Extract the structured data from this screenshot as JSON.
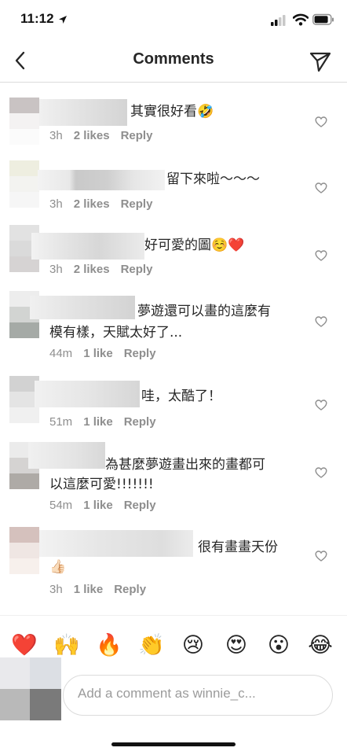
{
  "status_bar": {
    "time": "11:12"
  },
  "header": {
    "title": "Comments"
  },
  "comments": [
    {
      "text": "其實很好看🤣",
      "time": "3h",
      "likes": "2 likes",
      "reply": "Reply"
    },
    {
      "text": "留下來啦～～～",
      "time": "3h",
      "likes": "2 likes",
      "reply": "Reply"
    },
    {
      "text": "好可愛的圖☺️❤️",
      "time": "3h",
      "likes": "2 likes",
      "reply": "Reply"
    },
    {
      "text_line1": "夢遊還可以畫的這麼有",
      "text_line2": "模有樣，天賦太好了...",
      "time": "44m",
      "likes": "1 like",
      "reply": "Reply"
    },
    {
      "text": "哇，太酷了！",
      "time": "51m",
      "likes": "1 like",
      "reply": "Reply"
    },
    {
      "text_line1": "為甚麼夢遊畫出來的畫都可",
      "text_line2": "以這麼可愛!!!!!!!",
      "time": "54m",
      "likes": "1 like",
      "reply": "Reply"
    },
    {
      "text": "很有畫畫天份",
      "text_line2": "👍🏻",
      "time": "3h",
      "likes": "1 like",
      "reply": "Reply"
    }
  ],
  "emoji_bar": [
    "❤️",
    "🙌",
    "🔥",
    "👏",
    "😢",
    "😍",
    "😮",
    "😂"
  ],
  "comment_input": {
    "placeholder": "Add a comment as winnie_c..."
  },
  "icons": {
    "back": "chevron-left-icon",
    "direct": "paper-plane-icon",
    "like": "heart-outline-icon"
  },
  "colors": {
    "text": "#262626",
    "meta": "#8e8e8e",
    "border": "#dbdbdb"
  }
}
